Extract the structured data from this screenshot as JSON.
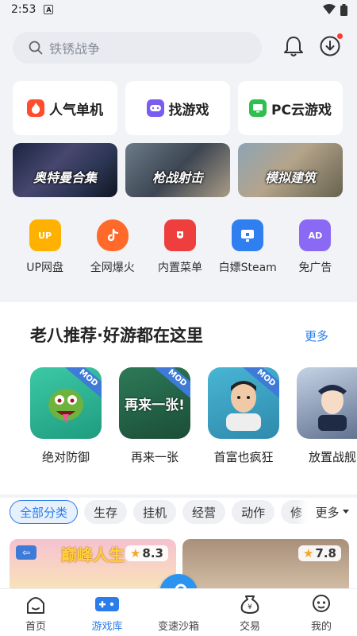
{
  "status": {
    "time": "2:53",
    "notif": "A"
  },
  "search": {
    "placeholder": "铁锈战争"
  },
  "quick_links": [
    {
      "label": "人气单机",
      "icon": "flame-icon",
      "color": "#ff4d2e"
    },
    {
      "label": "找游戏",
      "icon": "gamepad-icon",
      "color": "#7b5cf0"
    },
    {
      "label": "PC云游戏",
      "icon": "cloud-pc-icon",
      "color": "#2fbf4f"
    }
  ],
  "banners": [
    {
      "label": "奥特曼合集"
    },
    {
      "label": "枪战射击"
    },
    {
      "label": "模拟建筑"
    }
  ],
  "tools": [
    {
      "label": "UP网盘",
      "icon": "up-cloud-icon",
      "color": "#ffb100"
    },
    {
      "label": "全网爆火",
      "icon": "tiktok-flame-icon",
      "color": "#ff6a2b"
    },
    {
      "label": "内置菜单",
      "icon": "menu-icon",
      "color": "#ef3e3e"
    },
    {
      "label": "白嫖Steam",
      "icon": "monitor-icon",
      "color": "#2f7ff0"
    },
    {
      "label": "免广告",
      "icon": "ad-free-icon",
      "color": "#8a6af5"
    }
  ],
  "recommend": {
    "title": "老八推荐·好游都在这里",
    "more": "更多",
    "badge": "MOD",
    "games": [
      {
        "name": "绝对防御"
      },
      {
        "name": "再来一张",
        "art": "再来一张!"
      },
      {
        "name": "首富也疯狂"
      },
      {
        "name": "放置战舰"
      }
    ]
  },
  "categories": {
    "items": [
      "全部分类",
      "生存",
      "挂机",
      "经营",
      "动作",
      "修"
    ],
    "active": 0,
    "more": "更多"
  },
  "cards": [
    {
      "title": "巅峰人生",
      "rating": "8.3"
    },
    {
      "title": "",
      "rating": "7.8"
    }
  ],
  "tabs": [
    {
      "label": "首页",
      "icon": "home-icon"
    },
    {
      "label": "游戏库",
      "icon": "gamepad-icon"
    },
    {
      "label": "变速沙箱",
      "icon": "key-icon"
    },
    {
      "label": "交易",
      "icon": "money-bag-icon"
    },
    {
      "label": "我的",
      "icon": "profile-icon"
    }
  ],
  "active_tab": 1,
  "colors": {
    "accent": "#2b7de9",
    "badge_red": "#ff3b30"
  }
}
